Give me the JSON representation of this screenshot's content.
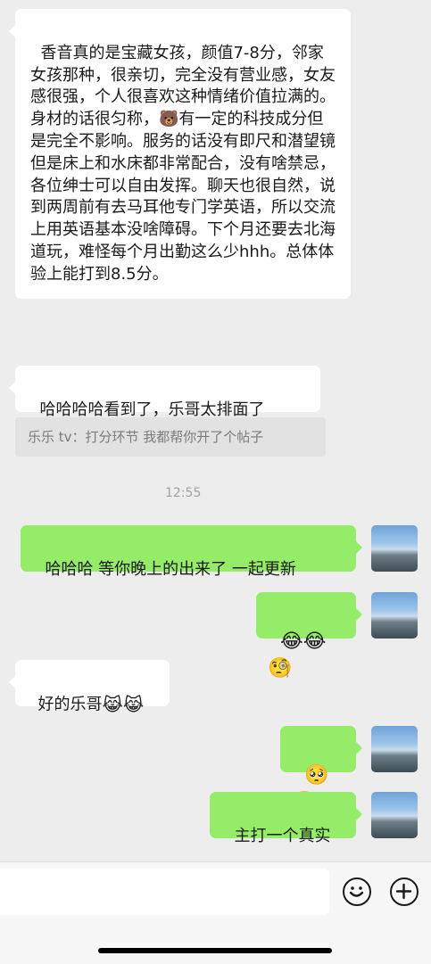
{
  "messages": [
    {
      "side": "in",
      "text": "香音真的是宝藏女孩，颜值7-8分，邻家女孩那种，很亲切，完全没有营业感，女友感很强，个人很喜欢这种情绪价值拉满的。身材的话很匀称，🐻有一定的科技成分但是完全不影响。服务的话没有即尺和潜望镜但是床上和水床都非常配合，没有啥禁忌，各位绅士可以自由发挥。聊天也很自然，说到两周前有去马耳他专门学英语，所以交流上用英语基本没啥障碍。下个月还要去北海道玩，难怪每个月出勤这么少hhh。总体体验上能打到8.5分。"
    },
    {
      "side": "in",
      "text": "哈哈哈哈看到了，乐哥太排面了",
      "quote": "乐乐 tv：打分环节 我都帮你开了个帖子"
    },
    {
      "type": "time",
      "text": "12:55"
    },
    {
      "side": "out",
      "text": "哈哈哈 等你晚上的出来了 一起更新"
    },
    {
      "side": "out",
      "emojis": [
        "😂",
        "😂",
        "🧐"
      ]
    },
    {
      "side": "in",
      "text": "好的乐哥",
      "emojis": [
        "😹",
        "😹"
      ]
    },
    {
      "side": "out",
      "emojis": [
        "🥺",
        "🥺"
      ]
    },
    {
      "side": "out",
      "text": "主打一个真实"
    }
  ],
  "input_bar": {
    "emoji_button": "emoji-face-icon",
    "more_button": "plus-icon"
  },
  "colors": {
    "background": "#ededed",
    "incoming_bubble": "#ffffff",
    "outgoing_bubble": "#95ec69",
    "quote_bg": "#e2e2e2"
  }
}
